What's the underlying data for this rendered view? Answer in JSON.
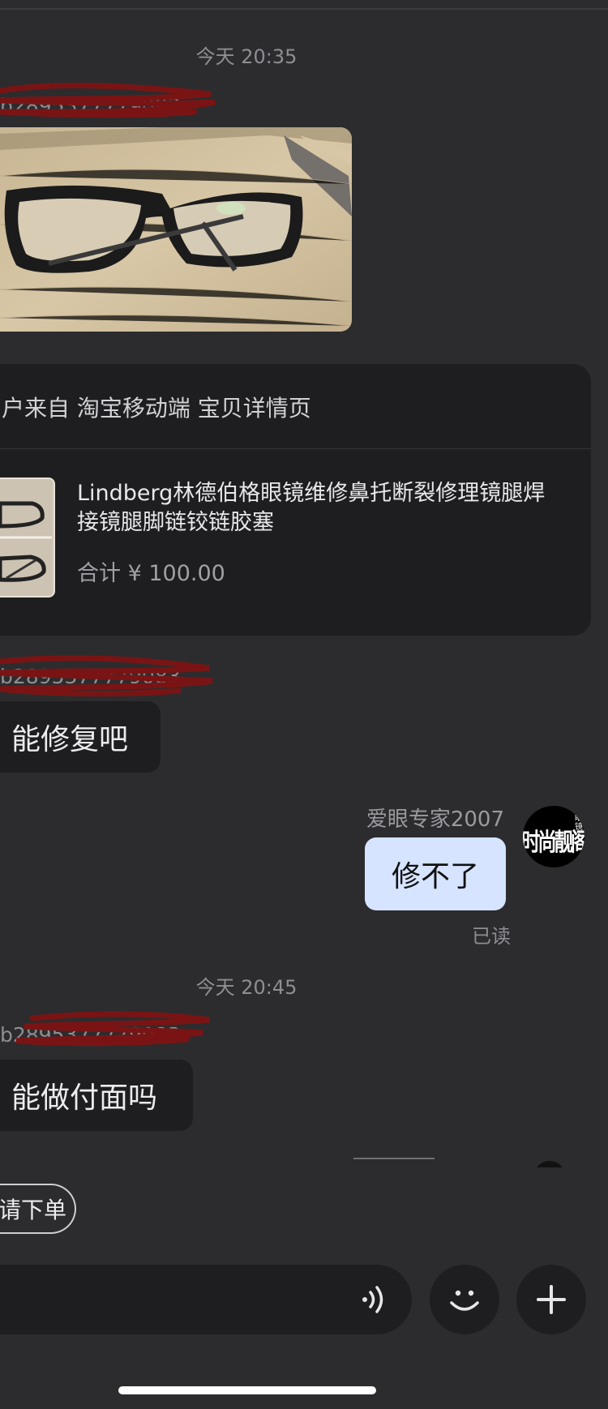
{
  "chat": {
    "timestamp_1": "今天 20:35",
    "customer_name_1": "b2895377779083",
    "product_card": {
      "source": "户来自 淘宝移动端 宝贝详情页",
      "title": "Lindberg林德伯格眼镜维修鼻托断裂修理镜腿焊接镜腿脚链铰链胶塞",
      "total": "合计 ¥ 100.00"
    },
    "customer_name_2": "b2895377779083",
    "message_1": "能修复吧",
    "agent_name": "爱眼专家2007",
    "agent_avatar_text": "时尚靓阁",
    "agent_avatar_subtext": "眼镜",
    "reply_1": "修不了",
    "read_status": "已读",
    "timestamp_2": "今天 20:45",
    "customer_name_3": "b2895377779083",
    "message_2": "能做付面吗"
  },
  "bottom": {
    "quick_reply": "请下单"
  },
  "colors": {
    "background": "#2c2c2e",
    "bubble_incoming": "#1e1e20",
    "bubble_outgoing": "#d6e4ff",
    "redaction": "#7a1414"
  }
}
